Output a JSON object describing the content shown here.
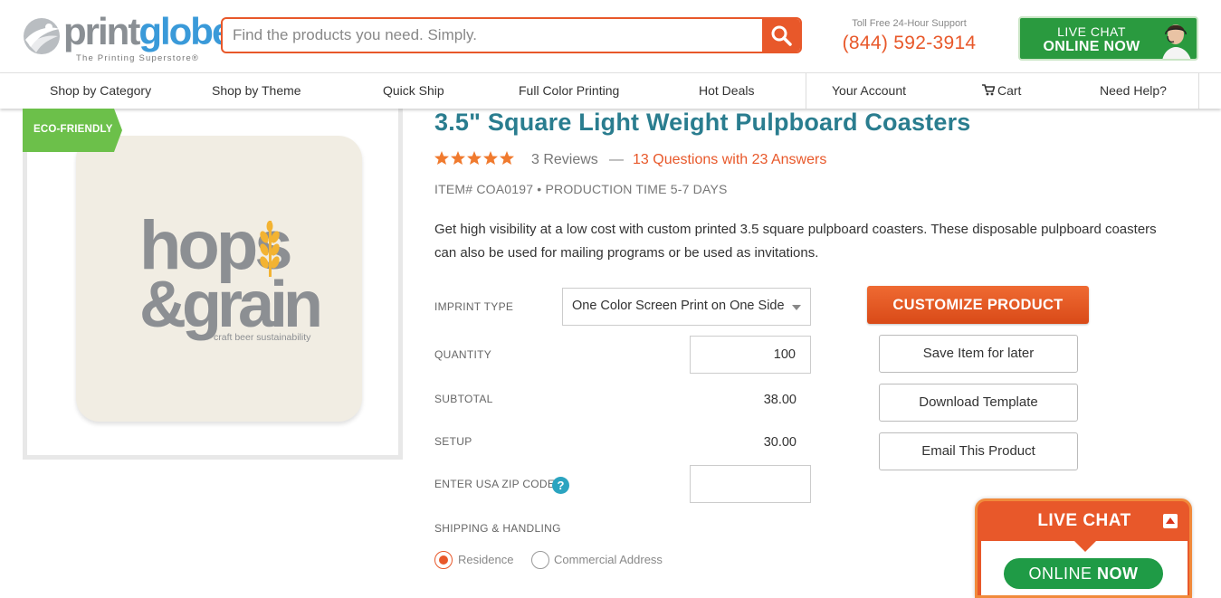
{
  "header": {
    "logo": {
      "word_gray": "print",
      "word_blue": "globe",
      "reg": "®",
      "tagline": "The Printing Superstore®"
    },
    "search": {
      "placeholder": "Find the products you need. Simply.",
      "button_icon": "search-icon"
    },
    "support": {
      "label": "Toll Free 24-Hour Support",
      "phone": "(844) 592-3914"
    },
    "live_chat": {
      "line1": "LIVE CHAT",
      "line2": "ONLINE NOW"
    }
  },
  "nav": {
    "items": [
      "Shop by Category",
      "Shop by Theme",
      "Quick Ship",
      "Full Color Printing",
      "Hot Deals"
    ],
    "account": "Your Account",
    "cart": "Cart",
    "help": "Need Help?"
  },
  "product": {
    "badge": "ECO-FRIENDLY",
    "title": "3.5\" Square Light Weight Pulpboard Coasters",
    "rating": 5,
    "reviews": "3 Reviews",
    "dash": "—",
    "questions": "13 Questions with 23 Answers",
    "item_line": "ITEM# COA0197 • PRODUCTION TIME 5-7 DAYS",
    "description": "Get high visibility at a low cost with custom printed 3.5 square pulpboard coasters. These disposable pulpboard coasters can also be used for mailing programs or be used as invitations.",
    "image_logo": {
      "line1": "hops",
      "line2": "&grain",
      "tagline": "craft beer sustainability"
    }
  },
  "form": {
    "imprint_label": "IMPRINT TYPE",
    "imprint_value": "One Color Screen Print on One Side",
    "quantity_label": "QUANTITY",
    "quantity_value": "100",
    "subtotal_label": "SUBTOTAL",
    "subtotal_value": "38.00",
    "setup_label": "SETUP",
    "setup_value": "30.00",
    "zip_label": "ENTER USA ZIP CODE",
    "zip_help": "?",
    "zip_value": "",
    "shipping_label": "SHIPPING & HANDLING",
    "shipping_options": [
      "Residence",
      "Commercial Address"
    ],
    "shipping_selected": "Residence"
  },
  "actions": {
    "customize": "CUSTOMIZE PRODUCT",
    "save": "Save Item for later",
    "download": "Download Template",
    "email": "Email This Product"
  },
  "floating_chat": {
    "title": "LIVE CHAT",
    "online": "ONLINE",
    "now": "NOW"
  },
  "colors": {
    "accent_orange": "#e8582a",
    "brand_blue": "#3a9ad9",
    "title_teal": "#2a7d8f",
    "eco_green": "#6cc04a",
    "chat_green": "#2a9a3f"
  }
}
